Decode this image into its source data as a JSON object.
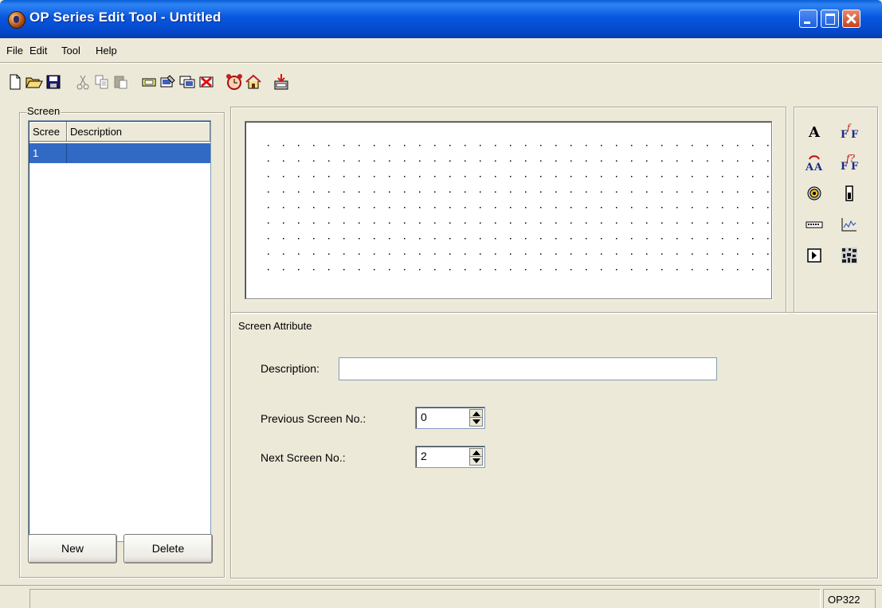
{
  "window": {
    "title": "OP Series Edit Tool - Untitled"
  },
  "menu": [
    "File",
    "Edit",
    "Tool",
    "Help"
  ],
  "toolbar": {
    "buttons": [
      "new",
      "open",
      "save",
      "cut",
      "copy",
      "paste",
      "add-screen",
      "screen-properties",
      "copy-screen",
      "delete-screen",
      "alarm",
      "home",
      "download"
    ]
  },
  "screen_panel": {
    "group_label": "Screen",
    "columns": [
      "Scree",
      "Description"
    ],
    "rows": [
      {
        "no": "1",
        "description": ""
      }
    ],
    "new_label": "New",
    "delete_label": "Delete"
  },
  "attributes": {
    "group_label": "Screen Attribute",
    "description_label": "Description:",
    "description_value": "",
    "prev_label": "Previous Screen No.:",
    "prev_value": "0",
    "next_label": "Next Screen No.:",
    "next_value": "2"
  },
  "palette": {
    "items": [
      "text-tool",
      "formula-text-tool",
      "swap-text-tool",
      "swap-formula-tool",
      "lamp-tool",
      "bar-tool",
      "numeric-entry-tool",
      "trend-chart-tool",
      "button-tool",
      "bitmap-tool"
    ]
  },
  "status": {
    "model": "OP322"
  }
}
